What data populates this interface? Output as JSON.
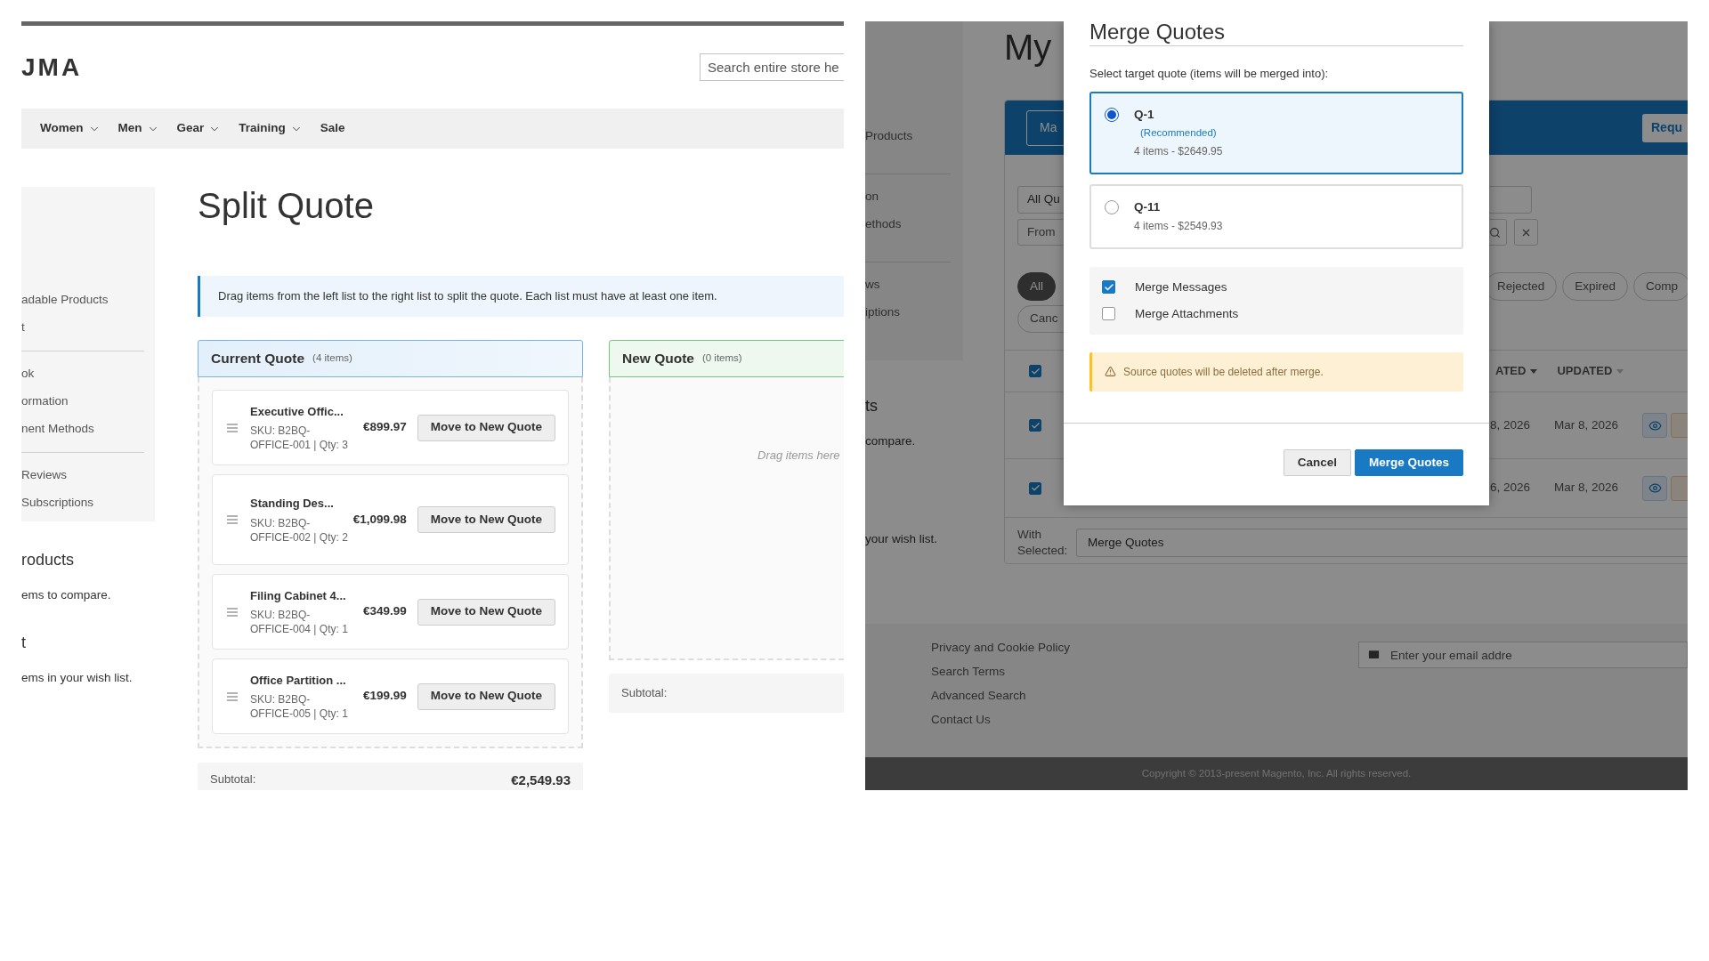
{
  "left": {
    "logo": "JMA",
    "search": {
      "placeholder": "Search entire store he"
    },
    "nav": [
      {
        "label": "Women",
        "dropdown": true
      },
      {
        "label": "Men",
        "dropdown": true
      },
      {
        "label": "Gear",
        "dropdown": true
      },
      {
        "label": "Training",
        "dropdown": true
      },
      {
        "label": "Sale",
        "dropdown": false
      }
    ],
    "sidebar_groups": [
      [
        "adable Products",
        "t"
      ],
      [
        "ok",
        "ormation",
        "nent Methods"
      ],
      [
        "Reviews",
        "Subscriptions"
      ]
    ],
    "side_blocks": [
      {
        "title": "roducts",
        "text": "ems to compare."
      },
      {
        "title": "t",
        "text": "ems in your wish list."
      }
    ],
    "title": "Split Quote",
    "notice": "Drag items from the left list to the right list to split the quote. Each list must have at least one item.",
    "current_quote": {
      "title": "Current Quote",
      "count": "(4 items)",
      "items": [
        {
          "name": "Executive Offic...",
          "sku": "SKU: B2BQ-OFFICE-001 | Qty: 3",
          "price": "€899.97",
          "button": "Move to New Quote"
        },
        {
          "name": "Standing Des...",
          "sku": "SKU: B2BQ-OFFICE-002 | Qty: 2",
          "price": "€1,099.98",
          "button": "Move to New Quote"
        },
        {
          "name": "Filing Cabinet 4...",
          "sku": "SKU: B2BQ-OFFICE-004 | Qty: 1",
          "price": "€349.99",
          "button": "Move to New Quote"
        },
        {
          "name": "Office Partition ...",
          "sku": "SKU: B2BQ-OFFICE-005 | Qty: 1",
          "price": "€199.99",
          "button": "Move to New Quote"
        }
      ],
      "subtotal_label": "Subtotal:",
      "subtotal": "€2,549.93"
    },
    "new_quote": {
      "title": "New Quote",
      "count": "(0 items)",
      "empty_text": "Drag items here",
      "subtotal_label": "Subtotal:"
    }
  },
  "right": {
    "sidebar_groups": [
      [
        "Products"
      ],
      [
        "on",
        "ethods"
      ],
      [
        "ws",
        "iptions"
      ]
    ],
    "side_blocks": [
      {
        "title": "ts",
        "text": "compare."
      },
      {
        "text": "your wish list."
      }
    ],
    "page_title": "My",
    "toolbar_buttons": [
      "Ma",
      "Requ"
    ],
    "status_select": "All Qu",
    "date_from": "From",
    "status_pills": [
      {
        "label": "All",
        "selected": true
      },
      {
        "label": "Rejected",
        "selected": false
      },
      {
        "label": "Expired",
        "selected": false
      },
      {
        "label": "Comp",
        "selected": false
      },
      {
        "label": "Canc",
        "selected": false
      }
    ],
    "header_checked": true,
    "columns": [
      {
        "label": "ATED",
        "sorted": true
      },
      {
        "label": "UPDATED",
        "sorted": false
      }
    ],
    "rows": [
      {
        "checked": true,
        "created": "8, 2026",
        "updated": "Mar 8, 2026"
      },
      {
        "checked": true,
        "created": "6, 2026",
        "updated": "Mar 8, 2026"
      }
    ],
    "with_selected_label": "With Selected:",
    "bulk_action": "Merge Quotes",
    "footer_links": [
      "Privacy and Cookie Policy",
      "Search Terms",
      "Advanced Search",
      "Contact Us"
    ],
    "newsletter": {
      "placeholder": "Enter your email addre"
    },
    "copyright": "Copyright © 2013-present Magento, Inc. All rights reserved.",
    "modal": {
      "title": "Merge Quotes",
      "prompt": "Select target quote (items will be merged into):",
      "options": [
        {
          "label": "Q-1",
          "note": "(Recommended)",
          "summary": "4 items - $2649.95",
          "selected": true
        },
        {
          "label": "Q-11",
          "summary": "4 items - $2549.93",
          "selected": false
        }
      ],
      "checkboxes": [
        {
          "label": "Merge Messages",
          "checked": true
        },
        {
          "label": "Merge Attachments",
          "checked": false
        }
      ],
      "warning": "Source quotes will be deleted after merge.",
      "buttons": [
        {
          "label": "Cancel",
          "kind": "secondary"
        },
        {
          "label": "Merge Quotes",
          "kind": "primary"
        }
      ]
    }
  }
}
